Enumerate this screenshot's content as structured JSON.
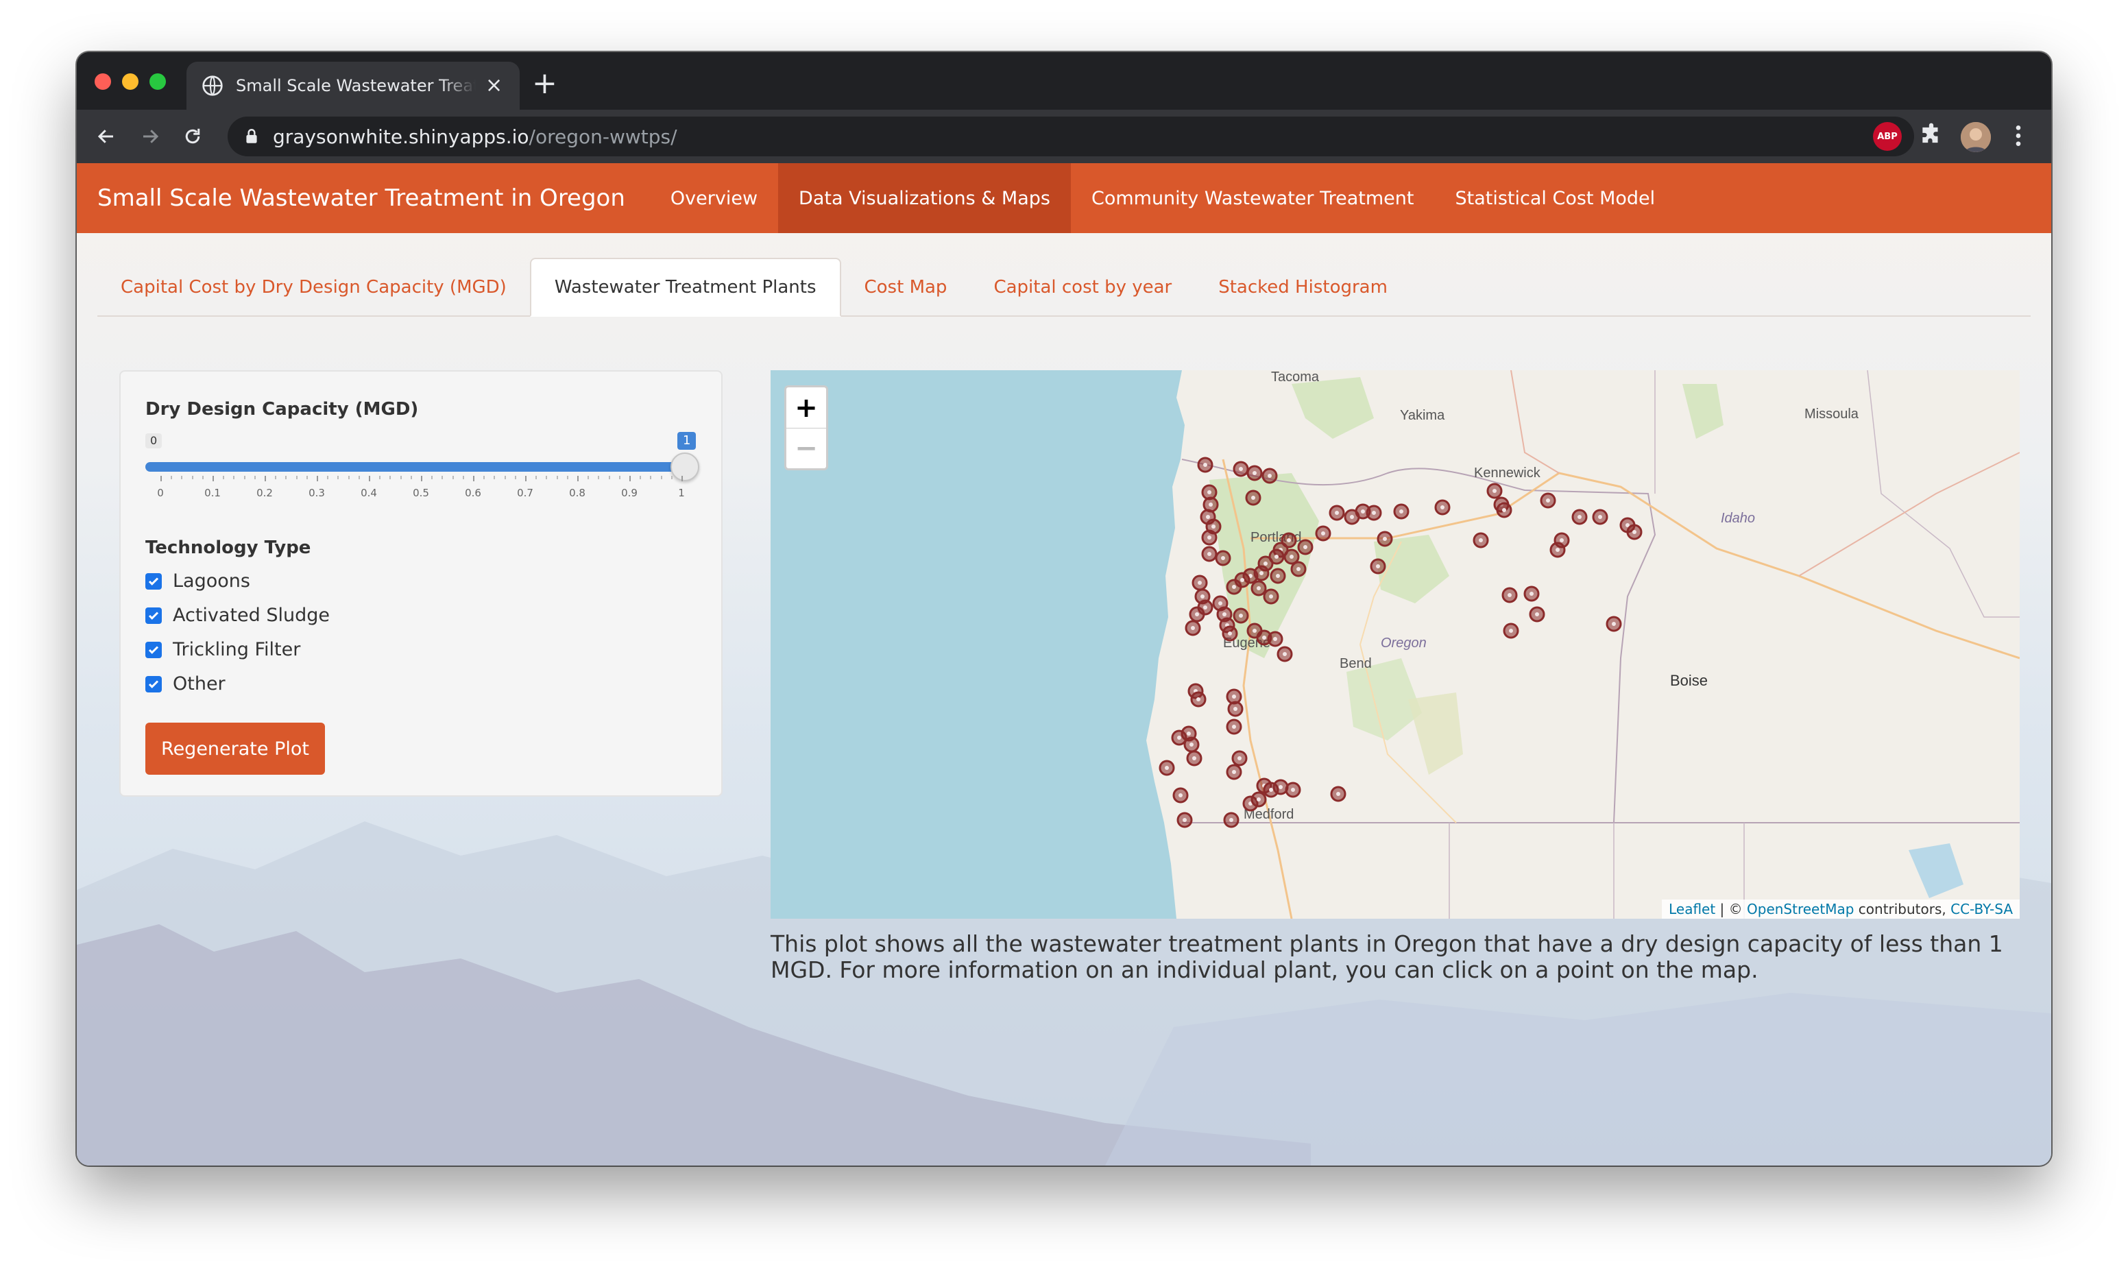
{
  "browser": {
    "tab_title": "Small Scale Wastewater Treatm",
    "url_host": "graysonwhite.shinyapps.io",
    "url_path": "/oregon-wwtps/",
    "abp_label": "ABP"
  },
  "navbar": {
    "brand": "Small Scale Wastewater Treatment in Oregon",
    "items": [
      {
        "label": "Overview",
        "active": false
      },
      {
        "label": "Data Visualizations & Maps",
        "active": true
      },
      {
        "label": "Community Wastewater Treatment",
        "active": false
      },
      {
        "label": "Statistical Cost Model",
        "active": false
      }
    ]
  },
  "tabs": [
    {
      "label": "Capital Cost by Dry Design Capacity (MGD)",
      "active": false
    },
    {
      "label": "Wastewater Treatment Plants",
      "active": true
    },
    {
      "label": "Cost Map",
      "active": false
    },
    {
      "label": "Capital cost by year",
      "active": false
    },
    {
      "label": "Stacked Histogram",
      "active": false
    }
  ],
  "sidebar": {
    "slider": {
      "label": "Dry Design Capacity (MGD)",
      "min_label": "0",
      "max_label": "1",
      "value": 1,
      "ticks": [
        "0",
        "0.1",
        "0.2",
        "0.3",
        "0.4",
        "0.5",
        "0.6",
        "0.7",
        "0.8",
        "0.9",
        "1"
      ]
    },
    "tech_label": "Technology Type",
    "tech_options": [
      {
        "label": "Lagoons",
        "checked": true
      },
      {
        "label": "Activated Sludge",
        "checked": true
      },
      {
        "label": "Trickling Filter",
        "checked": true
      },
      {
        "label": "Other",
        "checked": true
      }
    ],
    "button": "Regenerate Plot"
  },
  "map": {
    "zoom_in": "+",
    "zoom_out": "−",
    "places": [
      "Tacoma",
      "Yakima",
      "Missoula",
      "Kennewick",
      "Idaho",
      "Portland",
      "Oregon",
      "Eugene",
      "Bend",
      "Boise",
      "Medford"
    ],
    "attribution": {
      "leaflet": "Leaflet",
      "sep": " | © ",
      "osm": "OpenStreetMap",
      "contrib": " contributors, ",
      "license": "CC-BY-SA"
    },
    "marker_color": "#8b2b2b"
  },
  "caption": "This plot shows all the wastewater treatment plants in Oregon that have a dry design capacity of less than 1 MGD. For more information on an individual plant, you can click on a point on the map."
}
